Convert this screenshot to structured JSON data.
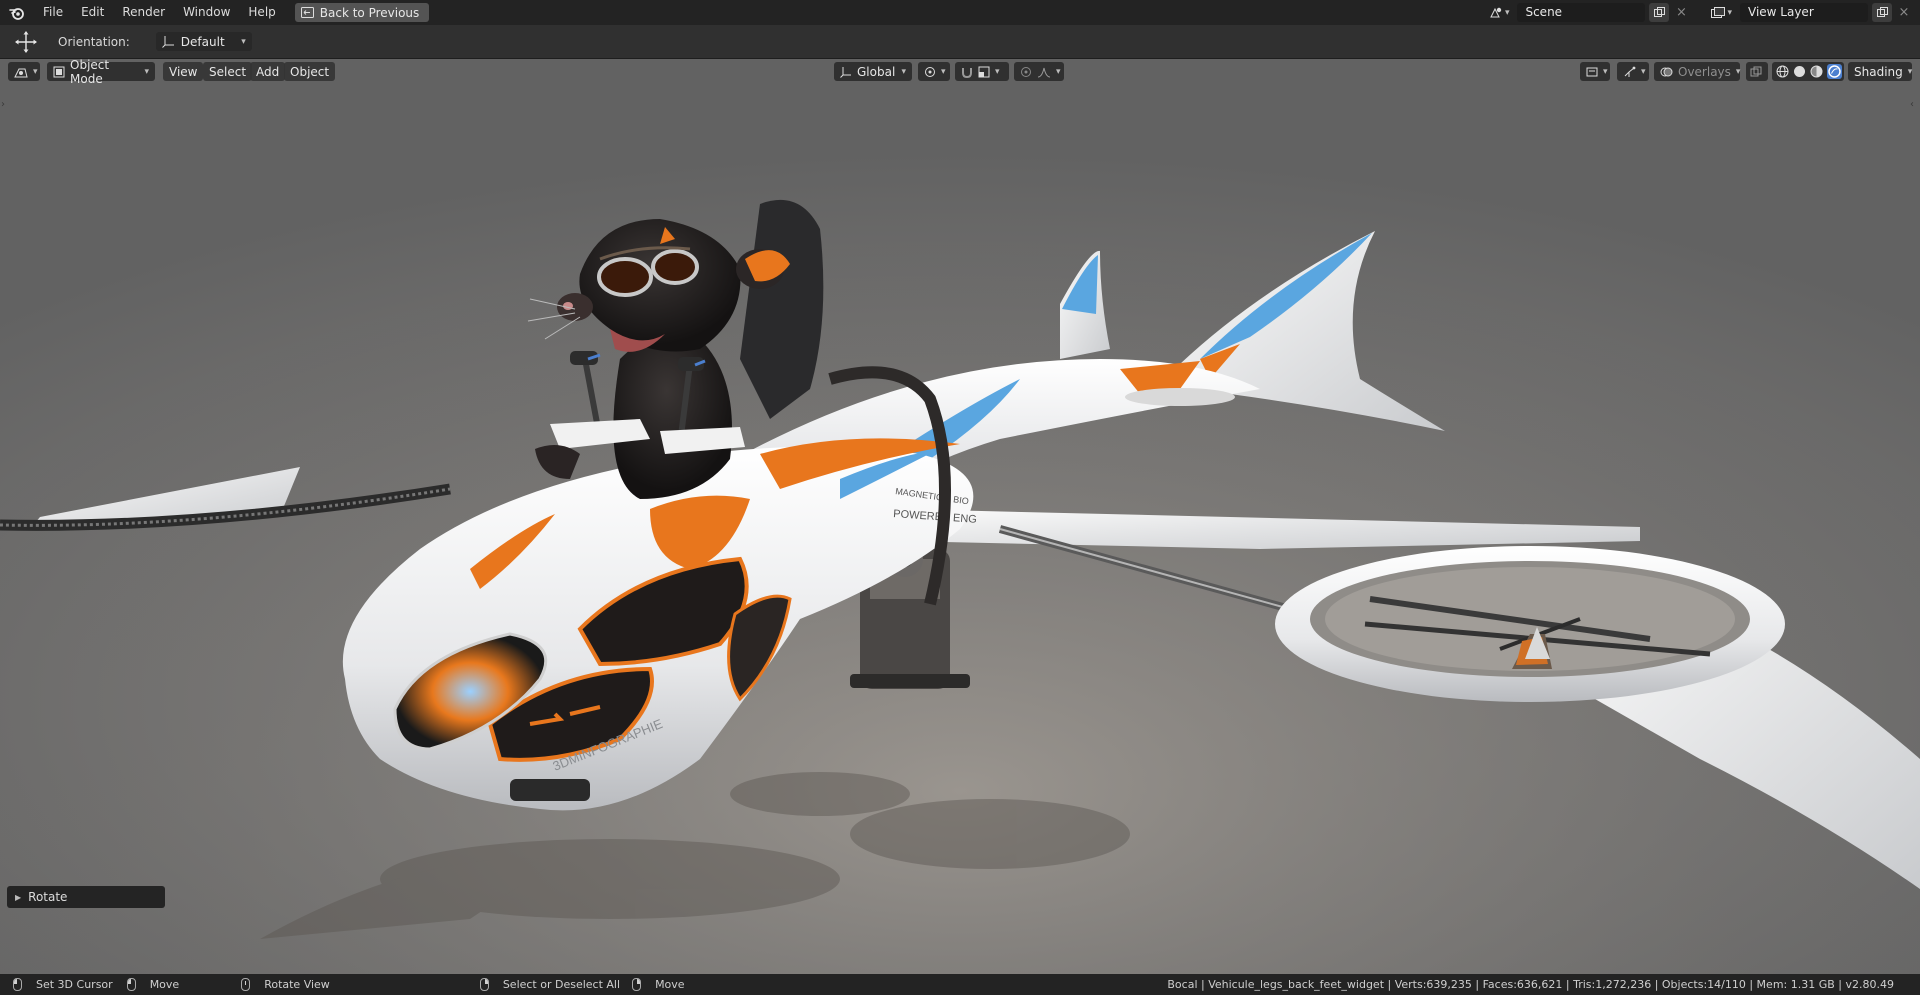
{
  "topbar": {
    "menu": [
      "File",
      "Edit",
      "Render",
      "Window",
      "Help"
    ],
    "back_button": "Back to Previous",
    "scene": "Scene",
    "view_layer": "View Layer"
  },
  "toolbar": {
    "orientation_label": "Orientation:",
    "orientation_value": "Default"
  },
  "viewport": {
    "mode": "Object Mode",
    "menus": [
      "View",
      "Select",
      "Add",
      "Object"
    ],
    "transform_orientation": "Global",
    "overlays": "Overlays",
    "shading": "Shading",
    "hull_text_1": "MAGNETIC & BIO",
    "hull_text_2": "POWERED ENG",
    "hull_logo": "3DMINFOGRAPHIE"
  },
  "operator_panel": {
    "label": "Rotate"
  },
  "statusbar": {
    "items": [
      "Set 3D Cursor",
      "Move",
      "Rotate View",
      "Select or Deselect All",
      "Move"
    ],
    "stats": "Bocal | Vehicule_legs_back_feet_widget | Verts:639,235 | Faces:636,621 | Tris:1,272,236 | Objects:14/110 | Mem: 1.31 GB | v2.80.49"
  },
  "colors": {
    "accent_blue": "#4b7fcf",
    "hull_orange": "#e8761d",
    "hull_blue": "#5aa6e0"
  }
}
